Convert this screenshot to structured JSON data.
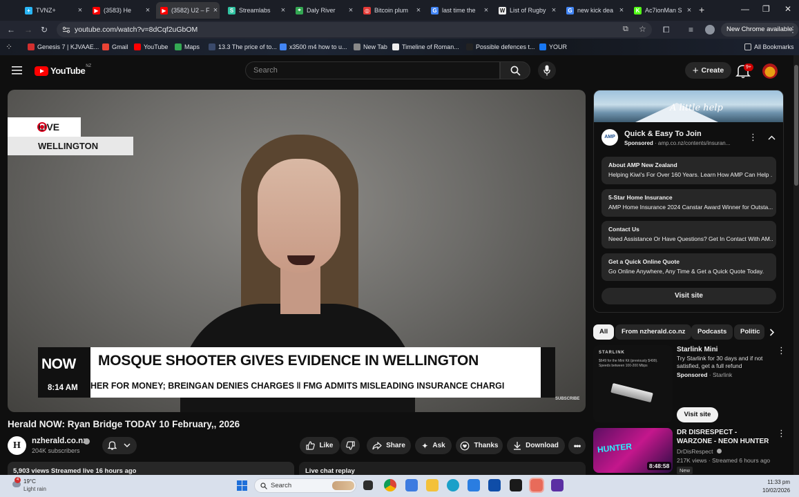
{
  "browser": {
    "tabs": [
      {
        "title": "TVNZ+",
        "color": "#29b6f6",
        "glyph": "+"
      },
      {
        "title": "(3583) He",
        "color": "#ff0000",
        "glyph": "▶"
      },
      {
        "title": "(3582) U2 – F",
        "color": "#ff0000",
        "glyph": "▶"
      },
      {
        "title": "Streamlabs",
        "color": "#31c3a2",
        "glyph": "S"
      },
      {
        "title": "Daly River",
        "color": "#34a853",
        "glyph": "⌖"
      },
      {
        "title": "Bitcoin plum",
        "color": "#e53935",
        "glyph": "◎"
      },
      {
        "title": "last time the",
        "color": "#4285f4",
        "glyph": "G"
      },
      {
        "title": "List of Rugby",
        "color": "#eeeeee",
        "glyph": "W"
      },
      {
        "title": "new kick dea",
        "color": "#4285f4",
        "glyph": "G"
      },
      {
        "title": "Ac7ionMan S",
        "color": "#53fc18",
        "glyph": "K"
      }
    ],
    "new_tab": "+",
    "url": "youtube.com/watch?v=8dCqf2uGbOM",
    "new_chrome_label": "New Chrome available",
    "bookmarks": [
      {
        "label": "Genesis 7 | KJVAAE...",
        "color": "#d32f2f"
      },
      {
        "label": "Gmail",
        "color": "#ea4335"
      },
      {
        "label": "YouTube",
        "color": "#ff0000"
      },
      {
        "label": "Maps",
        "color": "#34a853"
      },
      {
        "label": "13.3 The price of to...",
        "color": "#3a4a6b"
      },
      {
        "label": "x3500 m4 how to u...",
        "color": "#4285f4"
      },
      {
        "label": "New Tab",
        "color": "#888888"
      },
      {
        "label": "Timeline of Roman...",
        "color": "#eeeeee"
      },
      {
        "label": "Possible defences t...",
        "color": "#222222"
      },
      {
        "label": "YOUR",
        "color": "#1877f2"
      }
    ],
    "all_bookmarks": "All Bookmarks"
  },
  "youtube": {
    "region": "NZ",
    "logo_text": "YouTube",
    "search_placeholder": "Search",
    "create_label": "Create",
    "notifications_badge": "9+"
  },
  "video": {
    "live_label": "LIVE",
    "location": "WELLINGTON",
    "brand": "NOW",
    "time": "8:14 AM",
    "headline": "MOSQUE SHOOTER GIVES EVIDENCE IN WELLINGTON",
    "ticker": "HER FOR MONEY; BREINGAN DENIES CHARGES   ‖   FMG ADMITS MISLEADING INSURANCE CHARGI",
    "subscribe_mark": "SUBSCRIBE",
    "title": "Herald NOW: Ryan Bridge TODAY 10 February,, 2026",
    "channel": {
      "name": "nzherald.co.nz",
      "subscribers": "204K subscribers",
      "initial": "H"
    },
    "actions": {
      "like": "Like",
      "share": "Share",
      "ask": "Ask",
      "thanks": "Thanks",
      "download": "Download"
    },
    "stats": "5,903 views  Streamed live 16 hours ago",
    "chat_replay": "Live chat replay"
  },
  "ad": {
    "banner_tagline": "A little help",
    "logo": "AMP",
    "title": "Quick & Easy To Join",
    "sponsored": "Sponsored",
    "domain": "amp.co.nz/contents/insuran...",
    "links": [
      {
        "title": "About AMP New Zealand",
        "desc": "Helping Kiwi's For Over 160 Years. Learn How AMP Can Help ..."
      },
      {
        "title": "5-Star Home Insurance",
        "desc": "AMP Home Insurance 2024 Canstar Award Winner for Outsta..."
      },
      {
        "title": "Contact Us",
        "desc": "Need Assistance Or Have Questions? Get In Contact With AM..."
      },
      {
        "title": "Get a Quick Online Quote",
        "desc": "Go Online Anywhere, Any Time & Get a Quick Quote Today."
      }
    ],
    "visit_label": "Visit site"
  },
  "chips": [
    "All",
    "From nzherald.co.nz",
    "Podcasts",
    "Politic"
  ],
  "recommendations": [
    {
      "title": "Starlink Mini",
      "desc": "Try Starlink for 30 days and if not satisfied, get a full refund",
      "sponsored": "Sponsored",
      "advertiser": "Starlink",
      "thumb_brand": "STARLINK",
      "thumb_text": "$649 for the Mini Kit (previously $499). Speeds between 100-200 Mbps",
      "visit_label": "Visit site"
    },
    {
      "title": "DR DISRESPECT - WARZONE - NEON HUNTER",
      "channel": "DrDisRespect",
      "meta": "217K views · Streamed 6 hours ago",
      "badge": "New",
      "duration": "8:48:58",
      "thumb_text": "HUNTER"
    }
  ],
  "taskbar": {
    "weather_temp": "19°C",
    "weather_desc": "Light rain",
    "weather_badge": "4",
    "search_label": "Search",
    "time": "11:33 pm",
    "date": "10/02/2026"
  }
}
